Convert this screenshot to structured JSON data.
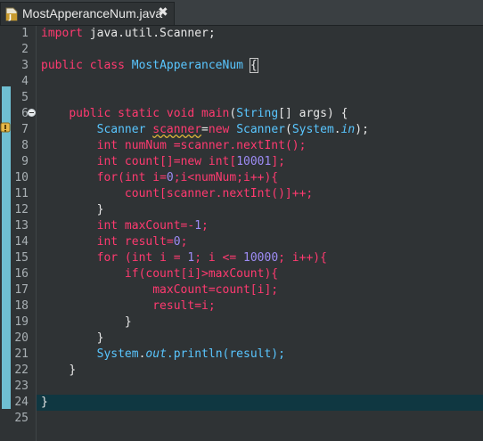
{
  "tab": {
    "title": "MostApperanceNum.java",
    "close": "✖",
    "icon": "java-file-icon"
  },
  "line_numbers": [
    "1",
    "2",
    "3",
    "4",
    "5",
    "6",
    "7",
    "8",
    "9",
    "10",
    "11",
    "12",
    "13",
    "14",
    "15",
    "16",
    "17",
    "18",
    "19",
    "20",
    "21",
    "22",
    "23",
    "24",
    "25"
  ],
  "code": {
    "l1_a": "import",
    "l1_b": " java.util.Scanner;",
    "l3_a": "public",
    "l3_b": " ",
    "l3_c": "class",
    "l3_d": " ",
    "l3_e": "MostApperanceNum",
    "l3_f": " ",
    "l3_g": "{",
    "l6_a": "public",
    "l6_b": "static",
    "l6_c": "void",
    "l6_d": "main",
    "l6_e": "(",
    "l6_f": "String",
    "l6_g": "[] args) {",
    "l7_a": "Scanner",
    "l7_b": "scanner",
    "l7_c": "=",
    "l7_d": "new",
    "l7_e": "Scanner",
    "l7_f": "(",
    "l7_g": "System",
    "l7_h": ".",
    "l7_i": "in",
    "l7_j": ");",
    "l8_a": "int",
    "l8_b": " numNum =scanner.nextInt();",
    "l9_a": "int",
    "l9_b": " count[]=",
    "l9_c": "new",
    "l9_d": " ",
    "l9_e": "int",
    "l9_f": "[",
    "l9_g": "10001",
    "l9_h": "];",
    "l10_a": "for",
    "l10_b": "(",
    "l10_c": "int",
    "l10_d": " i=",
    "l10_e": "0",
    "l10_f": ";i<numNum;i++){",
    "l11": "count[scanner.nextInt()]++;",
    "l12": "}",
    "l13_a": "int",
    "l13_b": " maxCount=-",
    "l13_c": "1",
    "l13_d": ";",
    "l14_a": "int",
    "l14_b": " result=",
    "l14_c": "0",
    "l14_d": ";",
    "l15_a": "for",
    "l15_b": " (",
    "l15_c": "int",
    "l15_d": " i = ",
    "l15_e": "1",
    "l15_f": "; i <= ",
    "l15_g": "10000",
    "l15_h": "; i++){",
    "l16_a": "if",
    "l16_b": "(count[i]>maxCount){",
    "l17": "maxCount=count[i];",
    "l18": "result=i;",
    "l19": "}",
    "l20": "}",
    "l21_a": "System",
    "l21_b": ".",
    "l21_c": "out",
    "l21_d": ".println(result);",
    "l22": "}",
    "l24": "}"
  },
  "colors": {
    "keyword": "#ff3a70",
    "type": "#59c6ff",
    "number": "#9e8cf5",
    "background": "#2f3335",
    "current_line": "#0f3741",
    "change_band": "#6fbfd2"
  }
}
